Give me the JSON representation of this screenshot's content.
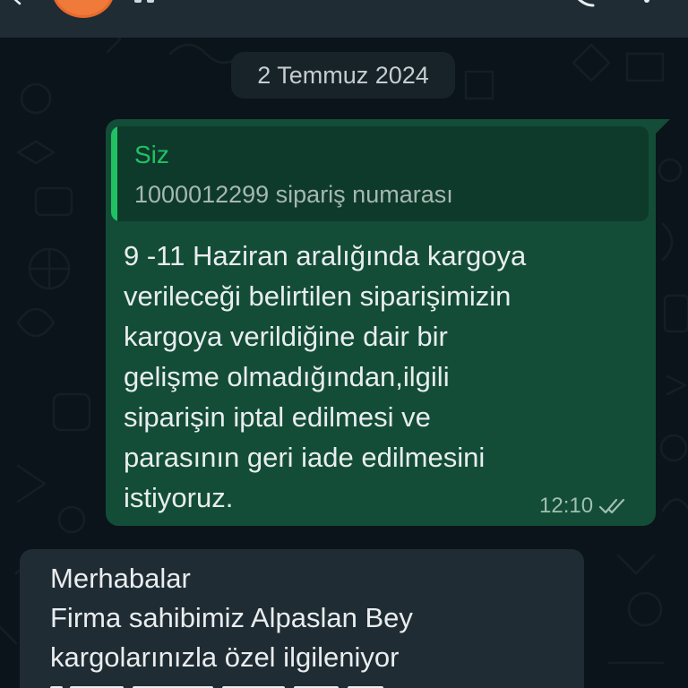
{
  "header": {
    "back_icon": "arrow-left-icon",
    "avatar_color": "#f07a3a",
    "call_icon": "phone-icon",
    "menu_icon": "more-vert-icon"
  },
  "date_chip": "2 Temmuz 2024",
  "outgoing_message": {
    "quote": {
      "author": "Siz",
      "text": "1000012299 sipariş numarası"
    },
    "lines": [
      "9 -11 Haziran aralığında kargoya",
      "verileceği belirtilen siparişimizin",
      "kargoya verildiğine dair bir",
      "gelişme olmadığından,ilgili",
      "siparişin iptal edilmesi ve",
      "parasının geri iade edilmesini",
      "istiyoruz."
    ],
    "time": "12:10",
    "status_icon": "double-check-icon"
  },
  "incoming_message": {
    "lines": [
      "Merhabalar",
      "Firma sahibimiz Alpaslan Bey",
      "kargolarınızla özel ilgileniyor"
    ]
  },
  "colors": {
    "background": "#0b141a",
    "outgoing_bubble": "#134d37",
    "incoming_bubble": "#202c33",
    "accent_green": "#21c063",
    "date_chip": "#182229"
  }
}
